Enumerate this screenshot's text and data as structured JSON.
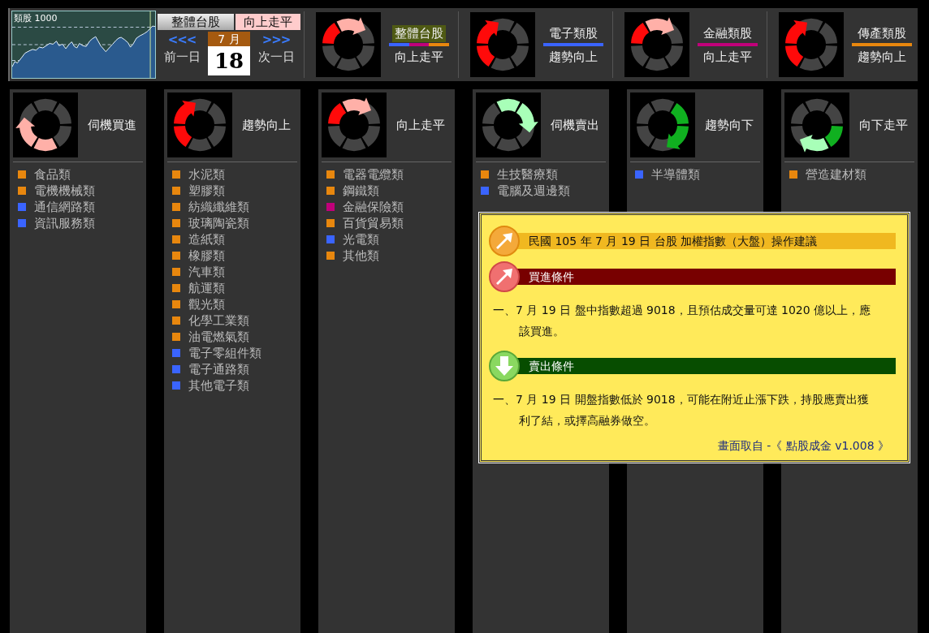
{
  "index_chart": {
    "label": "類股 1000"
  },
  "market": {
    "name": "整體台股",
    "status": "向上走平"
  },
  "date_nav": {
    "prev_arrows": "<<<",
    "prev_label": "前一日",
    "month": "7 月",
    "day": "18",
    "next_arrows": ">>>",
    "next_label": "次一日"
  },
  "summaries": [
    {
      "kind": "up-flat",
      "title": "整體台股",
      "selected": true,
      "underline": [
        {
          "color": "#3a64ff"
        },
        {
          "color": "#c0007a"
        },
        {
          "color": "#e8870e"
        }
      ],
      "status": "向上走平"
    },
    {
      "kind": "up",
      "title": "電子類股",
      "selected": false,
      "underline": [
        {
          "color": "#3a64ff"
        }
      ],
      "status": "趨勢向上"
    },
    {
      "kind": "up-flat",
      "title": "金融類股",
      "selected": false,
      "underline": [
        {
          "color": "#c0007a"
        }
      ],
      "status": "向上走平"
    },
    {
      "kind": "up",
      "title": "傳產類股",
      "selected": false,
      "underline": [
        {
          "color": "#e8870e"
        }
      ],
      "status": "趨勢向上"
    }
  ],
  "columns": [
    {
      "kind": "rebound",
      "label": "伺機買進",
      "items": [
        {
          "name": "食品類",
          "color": "#e8870e"
        },
        {
          "name": "電機機械類",
          "color": "#e8870e"
        },
        {
          "name": "通信網路類",
          "color": "#3a64ff"
        },
        {
          "name": "資訊服務類",
          "color": "#3a64ff"
        }
      ]
    },
    {
      "kind": "up",
      "label": "趨勢向上",
      "items": [
        {
          "name": "水泥類",
          "color": "#e8870e"
        },
        {
          "name": "塑膠類",
          "color": "#e8870e"
        },
        {
          "name": "紡織纖維類",
          "color": "#e8870e"
        },
        {
          "name": "玻璃陶瓷類",
          "color": "#e8870e"
        },
        {
          "name": "造紙類",
          "color": "#e8870e"
        },
        {
          "name": "橡膠類",
          "color": "#e8870e"
        },
        {
          "name": "汽車類",
          "color": "#e8870e"
        },
        {
          "name": "航運類",
          "color": "#e8870e"
        },
        {
          "name": "觀光類",
          "color": "#e8870e"
        },
        {
          "name": "化學工業類",
          "color": "#e8870e"
        },
        {
          "name": "油電燃氣類",
          "color": "#e8870e"
        },
        {
          "name": "電子零組件類",
          "color": "#3a64ff"
        },
        {
          "name": "電子通路類",
          "color": "#3a64ff"
        },
        {
          "name": "其他電子類",
          "color": "#3a64ff"
        }
      ]
    },
    {
      "kind": "up-flat",
      "label": "向上走平",
      "items": [
        {
          "name": "電器電纜類",
          "color": "#e8870e"
        },
        {
          "name": "鋼鐵類",
          "color": "#e8870e"
        },
        {
          "name": "金融保險類",
          "color": "#c0007a"
        },
        {
          "name": "百貨貿易類",
          "color": "#e8870e"
        },
        {
          "name": "光電類",
          "color": "#3a64ff"
        },
        {
          "name": "其他類",
          "color": "#e8870e"
        }
      ]
    },
    {
      "kind": "sell",
      "label": "伺機賣出",
      "items": [
        {
          "name": "生技醫療類",
          "color": "#e8870e"
        },
        {
          "name": "電腦及週邊類",
          "color": "#3a64ff"
        }
      ]
    },
    {
      "kind": "down",
      "label": "趨勢向下",
      "items": [
        {
          "name": "半導體類",
          "color": "#3a64ff"
        }
      ]
    },
    {
      "kind": "down-flat",
      "label": "向下走平",
      "items": [
        {
          "name": "營造建材類",
          "color": "#e8870e"
        }
      ]
    }
  ],
  "advice": {
    "title": "民國 105 年 7 月 19 日 台股 加權指數（大盤）操作建議",
    "sections": [
      {
        "kind": "buy",
        "heading": "買進條件",
        "text": "一、7 月 19 日 盤中指數超過 9018，且預估成交量可達 1020 億以上，應該買進。"
      },
      {
        "kind": "sell",
        "heading": "賣出條件",
        "text": "一、7 月 19 日 開盤指數低於 9018，可能在附近止漲下跌，持股應賣出獲利了結，或擇高融券做空。"
      }
    ],
    "source": "畫面取自 -《 點股成金 v1.008 》"
  }
}
